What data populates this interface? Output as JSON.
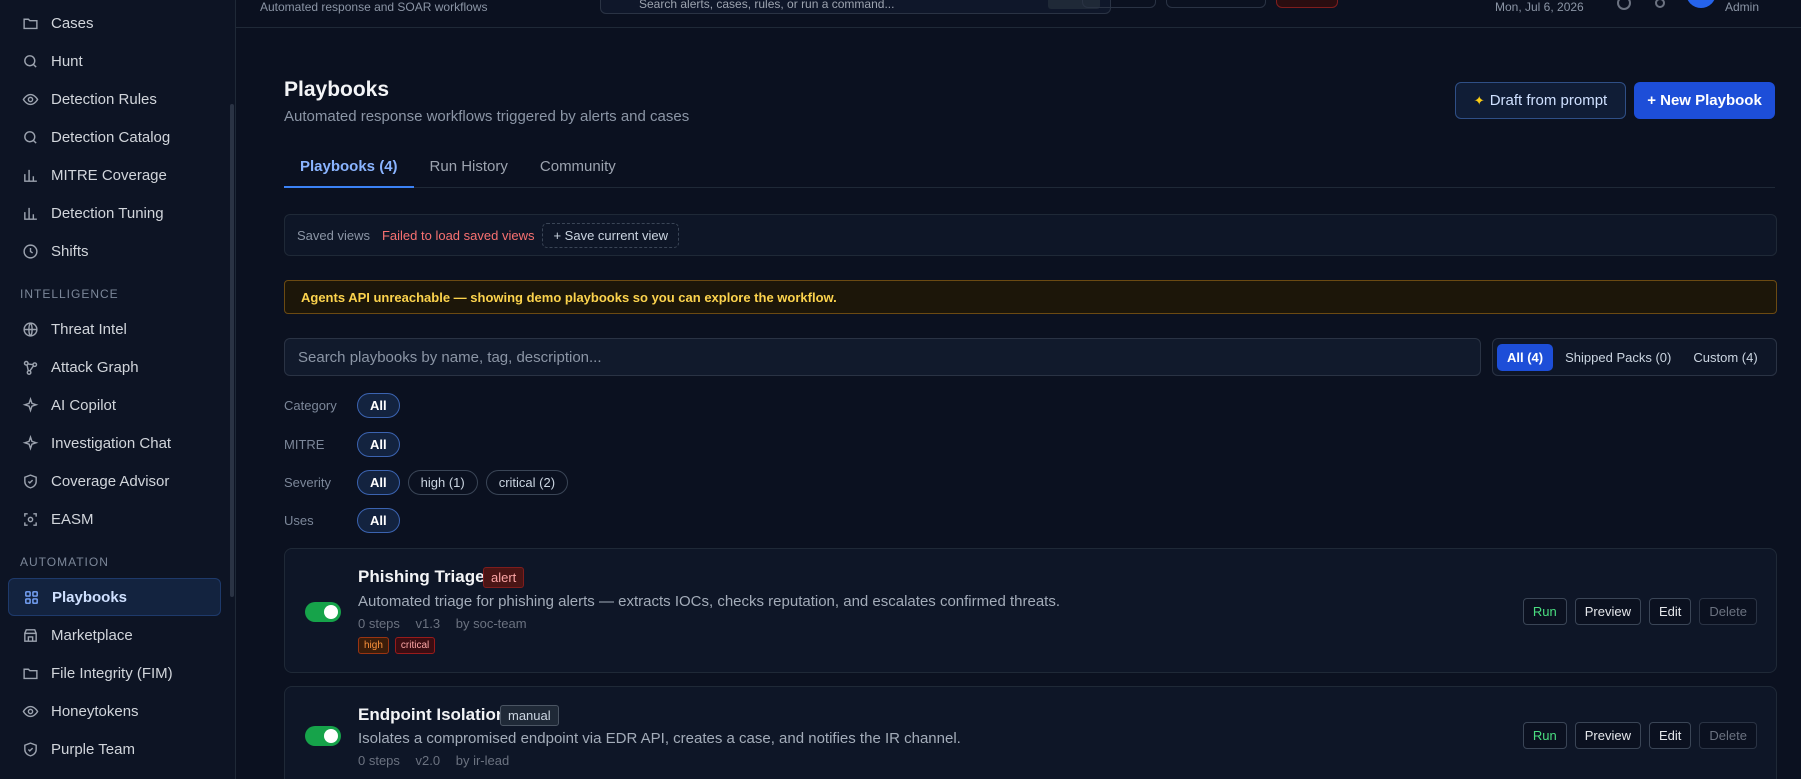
{
  "sidebar": {
    "items_top": [
      {
        "label": "Cases",
        "icon": "folder-icon"
      },
      {
        "label": "Hunt",
        "icon": "search-icon"
      },
      {
        "label": "Detection Rules",
        "icon": "eye-icon"
      },
      {
        "label": "Detection Catalog",
        "icon": "search-icon"
      },
      {
        "label": "MITRE Coverage",
        "icon": "bar-chart-icon"
      },
      {
        "label": "Detection Tuning",
        "icon": "bar-chart-icon"
      },
      {
        "label": "Shifts",
        "icon": "clock-icon"
      }
    ],
    "section_intelligence": "INTELLIGENCE",
    "items_intel": [
      {
        "label": "Threat Intel",
        "icon": "globe-icon"
      },
      {
        "label": "Attack Graph",
        "icon": "graph-icon"
      },
      {
        "label": "AI Copilot",
        "icon": "sparkle-icon"
      },
      {
        "label": "Investigation Chat",
        "icon": "sparkle-icon"
      },
      {
        "label": "Coverage Advisor",
        "icon": "shield-icon"
      },
      {
        "label": "EASM",
        "icon": "scan-icon"
      }
    ],
    "section_automation": "AUTOMATION",
    "items_auto": [
      {
        "label": "Playbooks",
        "icon": "grid-icon"
      },
      {
        "label": "Marketplace",
        "icon": "store-icon"
      },
      {
        "label": "File Integrity (FIM)",
        "icon": "folder-icon"
      },
      {
        "label": "Honeytokens",
        "icon": "eye-icon"
      },
      {
        "label": "Purple Team",
        "icon": "shield-icon"
      }
    ]
  },
  "topbar": {
    "subtitle": "Automated response and SOAR workflows",
    "search_placeholder": "Search alerts, cases, rules, or run a command...",
    "date": "Mon, Jul 6, 2026",
    "user": "Admin"
  },
  "header": {
    "title": "Playbooks",
    "description": "Automated response workflows triggered by alerts and cases",
    "draft_button": "Draft from prompt",
    "new_button": "+ New Playbook"
  },
  "tabs": [
    {
      "label": "Playbooks (4)"
    },
    {
      "label": "Run History"
    },
    {
      "label": "Community"
    }
  ],
  "saved_views": {
    "label": "Saved views",
    "error": "Failed to load saved views",
    "save_button": "+ Save current view"
  },
  "banner": "Agents API unreachable — showing demo playbooks so you can explore the workflow.",
  "search_placeholder": "Search playbooks by name, tag, description...",
  "segments": [
    "All (4)",
    "Shipped Packs (0)",
    "Custom (4)"
  ],
  "filters": {
    "category": {
      "label": "Category",
      "chips": [
        "All"
      ]
    },
    "mitre": {
      "label": "MITRE",
      "chips": [
        "All"
      ]
    },
    "severity": {
      "label": "Severity",
      "chips": [
        "All",
        "high (1)",
        "critical (2)"
      ]
    },
    "uses": {
      "label": "Uses",
      "chips": [
        "All"
      ]
    }
  },
  "actions": {
    "run": "Run",
    "preview": "Preview",
    "edit": "Edit",
    "delete": "Delete"
  },
  "playbooks": [
    {
      "name": "Phishing Triage",
      "trigger": "alert",
      "description": "Automated triage for phishing alerts — extracts IOCs, checks reputation, and escalates confirmed threats.",
      "steps": "0 steps",
      "version": "v1.3",
      "author": "by soc-team",
      "tags": [
        "high",
        "critical"
      ],
      "enabled": true
    },
    {
      "name": "Endpoint Isolation",
      "trigger": "manual",
      "description": "Isolates a compromised endpoint via EDR API, creates a case, and notifies the IR channel.",
      "steps": "0 steps",
      "version": "v2.0",
      "author": "by ir-lead",
      "enabled": true
    }
  ],
  "colors": {
    "accent": "#1d4ed8",
    "success": "#16a34a",
    "warning": "#fcd34d",
    "danger": "#f87171"
  }
}
